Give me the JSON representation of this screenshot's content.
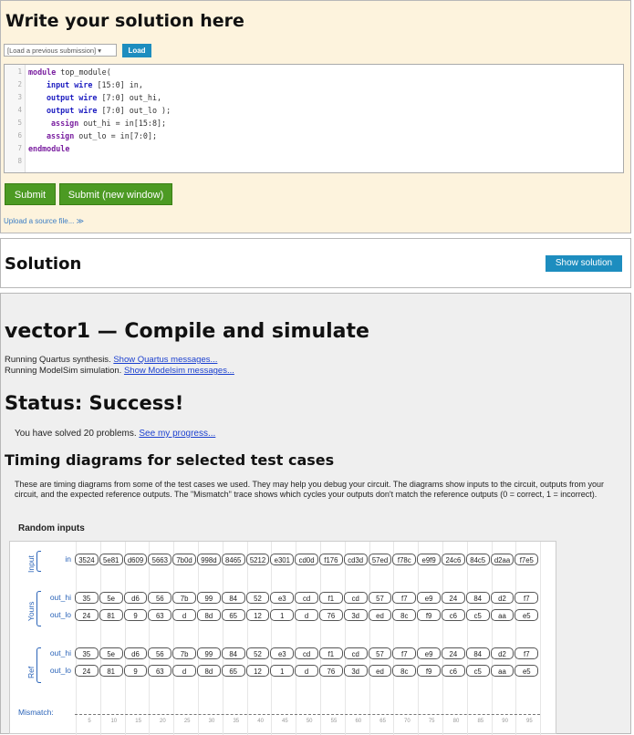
{
  "editor_panel": {
    "title": "Write your solution here",
    "load_select": "[Load a previous submission] ▾",
    "load_button": "Load",
    "line_numbers": [
      "1",
      "2",
      "3",
      "4",
      "5",
      "6",
      "7",
      "8"
    ],
    "code": {
      "l1a": "module",
      "l1b": " top_module(",
      "l2a": "input wire",
      "l2b": " [15:0] in,",
      "l3a": "output wire",
      "l3b": " [7:0] out_hi,",
      "l4a": "output wire",
      "l4b": " [7:0] out_lo );",
      "l5a": "assign",
      "l5b": " out_hi = in[15:8];",
      "l6a": "assign",
      "l6b": " out_lo = in[7:0];",
      "l7a": "endmodule"
    },
    "submit": "Submit",
    "submit_new": "Submit (new window)",
    "upload": "Upload a source file...  ≫"
  },
  "solution_panel": {
    "title": "Solution",
    "show_button": "Show solution"
  },
  "result_panel": {
    "title": "vector1 — Compile and simulate",
    "quartus_text": "Running Quartus synthesis. ",
    "quartus_link": "Show Quartus messages...",
    "modelsim_text": "Running ModelSim simulation. ",
    "modelsim_link": "Show Modelsim messages...",
    "status": "Status: Success!",
    "solved_text": "You have solved 20 problems. ",
    "progress_link": "See my progress...",
    "timing_title": "Timing diagrams for selected test cases",
    "timing_desc": "These are timing diagrams from some of the test cases we used. They may help you debug your circuit. The diagrams show inputs to the circuit, outputs from your circuit, and the expected reference outputs. The \"Mismatch\" trace shows which cycles your outputs don't match the reference outputs (0 = correct, 1 = incorrect).",
    "random_inputs": "Random inputs"
  },
  "waveform": {
    "groups": {
      "input": "Input",
      "yours": "Yours",
      "ref": "Ref"
    },
    "signals": {
      "in": "in",
      "yours_hi": "out_hi",
      "yours_lo": "out_lo",
      "ref_hi": "out_hi",
      "ref_lo": "out_lo"
    },
    "in": [
      "3524",
      "5e81",
      "d609",
      "5663",
      "7b0d",
      "998d",
      "8465",
      "5212",
      "e301",
      "cd0d",
      "f176",
      "cd3d",
      "57ed",
      "f78c",
      "e9f9",
      "24c6",
      "84c5",
      "d2aa",
      "f7e5"
    ],
    "out_hi": [
      "35",
      "5e",
      "d6",
      "56",
      "7b",
      "99",
      "84",
      "52",
      "e3",
      "cd",
      "f1",
      "cd",
      "57",
      "f7",
      "e9",
      "24",
      "84",
      "d2",
      "f7"
    ],
    "out_lo": [
      "24",
      "81",
      "9",
      "63",
      "d",
      "8d",
      "65",
      "12",
      "1",
      "d",
      "76",
      "3d",
      "ed",
      "8c",
      "f9",
      "c6",
      "c5",
      "aa",
      "e5"
    ],
    "mismatch_label": "Mismatch:",
    "ticks": [
      "5",
      "10",
      "15",
      "20",
      "25",
      "30",
      "35",
      "40",
      "45",
      "50",
      "55",
      "60",
      "65",
      "70",
      "75",
      "80",
      "85",
      "90",
      "95"
    ]
  }
}
